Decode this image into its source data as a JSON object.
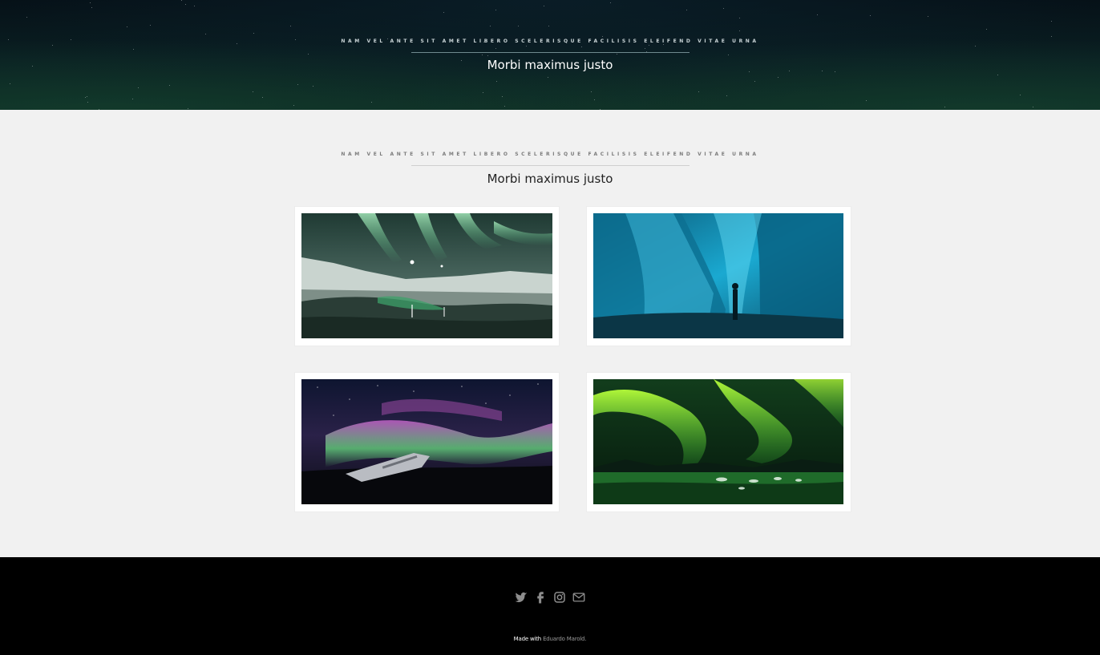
{
  "hero": {
    "eyebrow": "Nam vel ante sit amet libero scelerisque facilisis eleifend vitae urna",
    "headline": "Morbi maximus justo"
  },
  "gallery": {
    "eyebrow": "Nam vel ante sit amet libero scelerisque facilisis eleifend vitae urna",
    "headline": "Morbi maximus justo",
    "photos": [
      {
        "name": "aurora-green-mountains-photo"
      },
      {
        "name": "ice-cave-photo"
      },
      {
        "name": "plane-wreck-aurora-photo"
      },
      {
        "name": "green-aurora-lagoon-photo"
      }
    ]
  },
  "footer": {
    "social_icons": [
      "twitter-icon",
      "facebook-icon",
      "instagram-icon",
      "envelope-icon"
    ],
    "credit_prefix": "Made with",
    "credit_author": "Eduardo Marold."
  }
}
